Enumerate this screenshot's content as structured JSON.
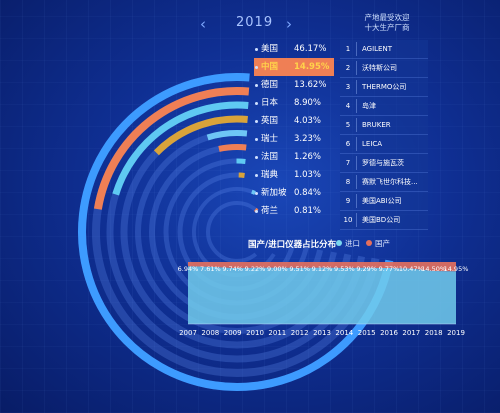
{
  "year_nav": {
    "year": "2019",
    "prev_icon": "chevron-left-icon",
    "next_icon": "chevron-right-icon"
  },
  "country_share": {
    "items": [
      {
        "name": "美国",
        "pct": "46.17%",
        "color": "#3d9bff"
      },
      {
        "name": "中国",
        "pct": "14.95%",
        "color": "#ef7f55",
        "highlight": true
      },
      {
        "name": "德国",
        "pct": "13.62%",
        "color": "#5fc9f2"
      },
      {
        "name": "日本",
        "pct": "8.90%",
        "color": "#d9a33a"
      },
      {
        "name": "英国",
        "pct": "4.03%",
        "color": "#6ec6f5"
      },
      {
        "name": "瑞士",
        "pct": "3.23%",
        "color": "#ef7f55"
      },
      {
        "name": "法国",
        "pct": "1.26%",
        "color": "#5fc9f2"
      },
      {
        "name": "瑞典",
        "pct": "1.03%",
        "color": "#d9a33a"
      },
      {
        "name": "新加坡",
        "pct": "0.84%",
        "color": "#6ec6f5"
      },
      {
        "name": "荷兰",
        "pct": "0.81%",
        "color": "#ef7f55"
      }
    ]
  },
  "top_producers": {
    "title_line1": "产地最受欢迎",
    "title_line2": "十大生产厂商",
    "items": [
      {
        "rank": "1",
        "name": "AGILENT"
      },
      {
        "rank": "2",
        "name": "沃特斯公司"
      },
      {
        "rank": "3",
        "name": "THERMO公司"
      },
      {
        "rank": "4",
        "name": "岛津"
      },
      {
        "rank": "5",
        "name": "BRUKER"
      },
      {
        "rank": "6",
        "name": "LEICA"
      },
      {
        "rank": "7",
        "name": "罗德与施瓦茨"
      },
      {
        "rank": "8",
        "name": "赛默飞世尔科技..."
      },
      {
        "rank": "9",
        "name": "美国ABI公司"
      },
      {
        "rank": "10",
        "name": "美国BD公司"
      }
    ]
  },
  "ratio_chart": {
    "title": "国产/进口仪器占比分布",
    "legend_import": "进口",
    "legend_domestic": "国产",
    "color_import": "#79d6ef",
    "color_domestic": "#e56f5c"
  },
  "chart_data": [
    {
      "type": "pie",
      "categories": [
        "美国",
        "中国",
        "德国",
        "日本",
        "英国",
        "瑞士",
        "法国",
        "瑞典",
        "新加坡",
        "荷兰"
      ],
      "values": [
        46.17,
        14.95,
        13.62,
        8.9,
        4.03,
        3.23,
        1.26,
        1.03,
        0.84,
        0.81
      ]
    },
    {
      "type": "area",
      "title": "国产/进口仪器占比分布",
      "x": [
        "2007",
        "2008",
        "2009",
        "2010",
        "2011",
        "2012",
        "2013",
        "2014",
        "2015",
        "2016",
        "2017",
        "2018",
        "2019"
      ],
      "labels": [
        "6.94%",
        "7.61%",
        "9.74%",
        "9.22%",
        "9.00%",
        "9.51%",
        "9.12%",
        "9.53%",
        "9.29%",
        "9.77%",
        "10.47%",
        "14.50%",
        "14.95%"
      ],
      "series": [
        {
          "name": "国产",
          "values": [
            6.94,
            7.61,
            9.74,
            9.22,
            9.0,
            9.51,
            9.12,
            9.53,
            9.29,
            9.77,
            10.47,
            14.5,
            14.95
          ]
        },
        {
          "name": "进口",
          "values": [
            93.06,
            92.39,
            90.26,
            90.78,
            91.0,
            90.49,
            90.88,
            90.47,
            90.71,
            90.23,
            89.53,
            85.5,
            85.05
          ]
        }
      ],
      "ylim": [
        0,
        100
      ],
      "legend": "top"
    }
  ]
}
